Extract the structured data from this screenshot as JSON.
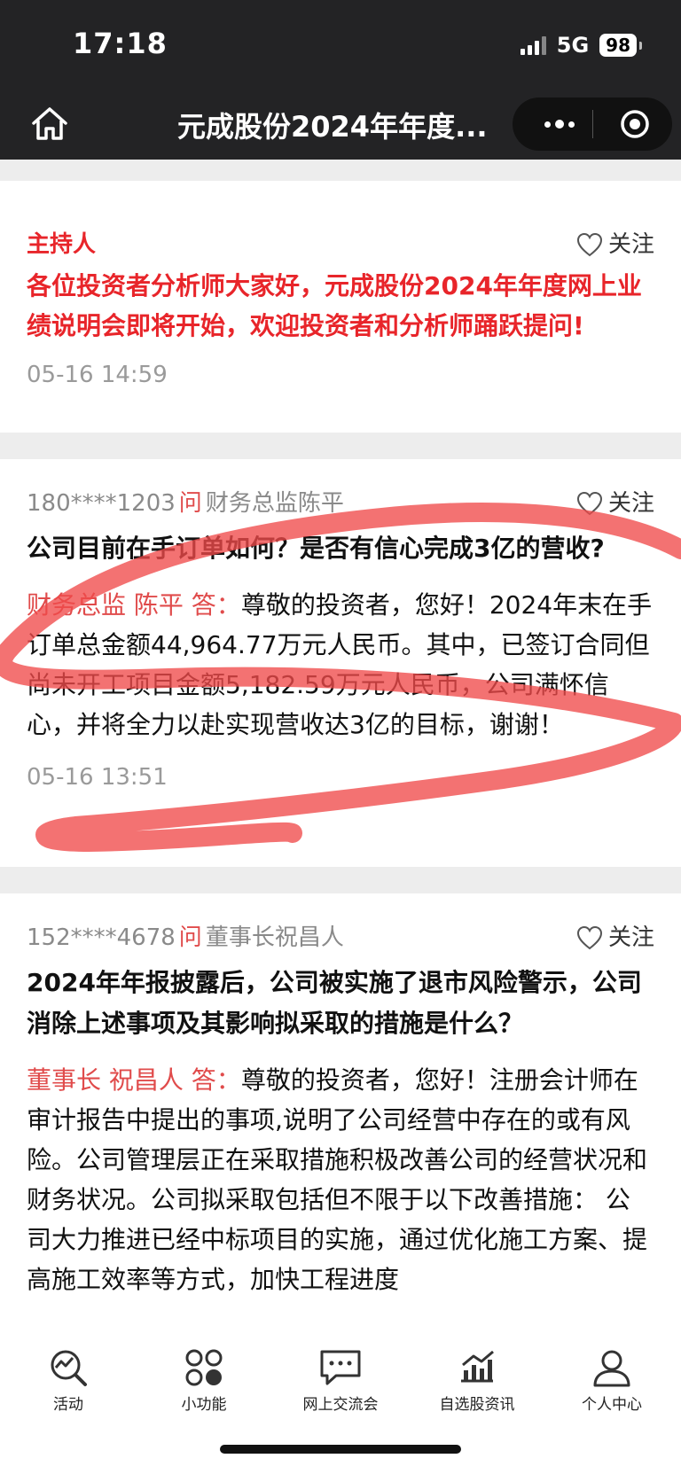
{
  "status": {
    "time": "17:18",
    "network": "5G",
    "battery": "98"
  },
  "nav": {
    "title": "元成股份2024年年度..."
  },
  "host_card": {
    "role": "主持人",
    "follow": "关注",
    "text": "各位投资者分析师大家好，元成股份2024年年度网上业绩说明会即将开始，欢迎投资者和分析师踊跃提问!",
    "time": "05-16 14:59"
  },
  "qa": [
    {
      "user": "180****1203",
      "ask": "问",
      "target": "财务总监陈平",
      "follow": "关注",
      "question": "公司目前在手订单如何？是否有信心完成3亿的营收?",
      "answerer": "财务总监 陈平 答：",
      "answer": "尊敬的投资者，您好！2024年末在手订单总金额44,964.77万元人民币。其中，已签订合同但尚未开工项目金额5,182.59万元人民币，公司满怀信心，并将全力以赴实现营收达3亿的目标，谢谢！",
      "time": "05-16 13:51"
    },
    {
      "user": "152****4678",
      "ask": "问",
      "target": "董事长祝昌人",
      "follow": "关注",
      "question": "2024年年报披露后，公司被实施了退市风险警示，公司消除上述事项及其影响拟采取的措施是什么？",
      "answerer": "董事长 祝昌人 答：",
      "answer": "尊敬的投资者，您好！注册会计师在审计报告中提出的事项,说明了公司经营中存在的或有风险。公司管理层正在采取措施积极改善公司的经营状况和财务状况。公司拟采取包括但不限于以下改善措施： 公司大力推进已经中标项目的实施，通过优化施工方案、提高施工效率等方式，加快工程进度"
    }
  ],
  "tabs": [
    {
      "label": "活动",
      "icon": "activity-chart-icon"
    },
    {
      "label": "小功能",
      "icon": "grid-apps-icon"
    },
    {
      "label": "网上交流会",
      "icon": "chat-bubble-icon"
    },
    {
      "label": "自选股资讯",
      "icon": "stock-chart-icon"
    },
    {
      "label": "个人中心",
      "icon": "user-icon"
    }
  ],
  "colors": {
    "accent_red": "#e8252a",
    "dark_bar": "#232325",
    "annotation": "#f04a4a"
  }
}
